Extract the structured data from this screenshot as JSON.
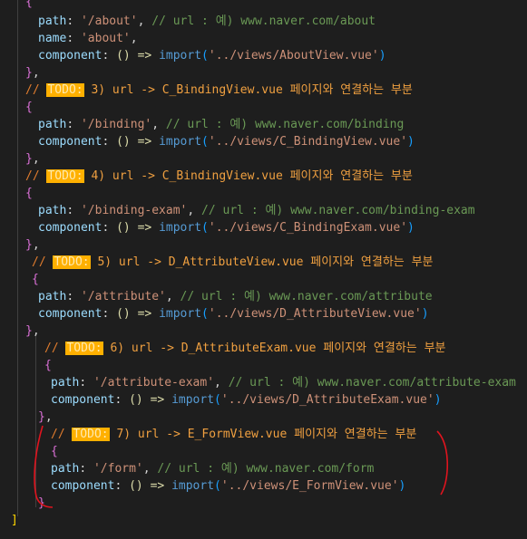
{
  "code": {
    "lines": [
      {
        "id": "l0",
        "segments": [
          {
            "t": "{",
            "c": "b2"
          }
        ]
      },
      {
        "id": "l1",
        "segments": [
          {
            "t": "path",
            "c": "k"
          },
          {
            "t": ": ",
            "c": "p"
          },
          {
            "t": "'/about'",
            "c": "s"
          },
          {
            "t": ", ",
            "c": "p"
          },
          {
            "t": "// url : 예) www.naver.com/about",
            "c": "c"
          }
        ]
      },
      {
        "id": "l2",
        "segments": [
          {
            "t": "name",
            "c": "k"
          },
          {
            "t": ": ",
            "c": "p"
          },
          {
            "t": "'about'",
            "c": "s"
          },
          {
            "t": ",",
            "c": "p"
          }
        ]
      },
      {
        "id": "l3",
        "segments": [
          {
            "t": "component",
            "c": "k"
          },
          {
            "t": ": ",
            "c": "p"
          },
          {
            "t": "() => ",
            "c": "f"
          },
          {
            "t": "import",
            "c": "kw"
          },
          {
            "t": "(",
            "c": "b3"
          },
          {
            "t": "'../views/AboutView.vue'",
            "c": "s"
          },
          {
            "t": ")",
            "c": "b3"
          }
        ]
      },
      {
        "id": "l4",
        "segments": [
          {
            "t": "}",
            "c": "b2"
          },
          {
            "t": ",",
            "c": "p"
          }
        ]
      },
      {
        "id": "l5",
        "todo": true,
        "segments": [
          {
            "t": "// ",
            "c": "todo-c"
          },
          {
            "t": "TODO:",
            "c": "todo"
          },
          {
            "t": " 3) url -> C_BindingView.vue 페이지와 연결하는 부분",
            "c": "todo-text"
          }
        ]
      },
      {
        "id": "l6",
        "segments": [
          {
            "t": "{",
            "c": "b2"
          }
        ]
      },
      {
        "id": "l7",
        "segments": [
          {
            "t": "path",
            "c": "k"
          },
          {
            "t": ": ",
            "c": "p"
          },
          {
            "t": "'/binding'",
            "c": "s"
          },
          {
            "t": ", ",
            "c": "p"
          },
          {
            "t": "// url : 예) www.naver.com/binding",
            "c": "c"
          }
        ]
      },
      {
        "id": "l8",
        "segments": [
          {
            "t": "component",
            "c": "k"
          },
          {
            "t": ": ",
            "c": "p"
          },
          {
            "t": "() => ",
            "c": "f"
          },
          {
            "t": "import",
            "c": "kw"
          },
          {
            "t": "(",
            "c": "b3"
          },
          {
            "t": "'../views/C_BindingView.vue'",
            "c": "s"
          },
          {
            "t": ")",
            "c": "b3"
          }
        ]
      },
      {
        "id": "l9",
        "segments": [
          {
            "t": "}",
            "c": "b2"
          },
          {
            "t": ",",
            "c": "p"
          }
        ]
      },
      {
        "id": "l10",
        "todo": true,
        "segments": [
          {
            "t": "// ",
            "c": "todo-c"
          },
          {
            "t": "TODO:",
            "c": "todo"
          },
          {
            "t": " 4) url -> C_BindingView.vue 페이지와 연결하는 부분",
            "c": "todo-text"
          }
        ]
      },
      {
        "id": "l11",
        "segments": [
          {
            "t": "{",
            "c": "b2"
          }
        ]
      },
      {
        "id": "l12",
        "segments": [
          {
            "t": "path",
            "c": "k"
          },
          {
            "t": ": ",
            "c": "p"
          },
          {
            "t": "'/binding-exam'",
            "c": "s"
          },
          {
            "t": ", ",
            "c": "p"
          },
          {
            "t": "// url : 예) www.naver.com/binding-exam",
            "c": "c"
          }
        ]
      },
      {
        "id": "l13",
        "segments": [
          {
            "t": "component",
            "c": "k"
          },
          {
            "t": ": ",
            "c": "p"
          },
          {
            "t": "() => ",
            "c": "f"
          },
          {
            "t": "import",
            "c": "kw"
          },
          {
            "t": "(",
            "c": "b3"
          },
          {
            "t": "'../views/C_BindingExam.vue'",
            "c": "s"
          },
          {
            "t": ")",
            "c": "b3"
          }
        ]
      },
      {
        "id": "l14",
        "segments": [
          {
            "t": "}",
            "c": "b2"
          },
          {
            "t": ",",
            "c": "p"
          }
        ]
      },
      {
        "id": "l15",
        "todo": true,
        "segments": [
          {
            "t": "// ",
            "c": "todo-c"
          },
          {
            "t": "TODO:",
            "c": "todo"
          },
          {
            "t": " 5) url -> D_AttributeView.vue 페이지와 연결하는 부분",
            "c": "todo-text"
          }
        ]
      },
      {
        "id": "l16",
        "segments": [
          {
            "t": "{",
            "c": "b2"
          }
        ]
      },
      {
        "id": "l17",
        "segments": [
          {
            "t": "path",
            "c": "k"
          },
          {
            "t": ": ",
            "c": "p"
          },
          {
            "t": "'/attribute'",
            "c": "s"
          },
          {
            "t": ", ",
            "c": "p"
          },
          {
            "t": "// url : 예) www.naver.com/attribute",
            "c": "c"
          }
        ]
      },
      {
        "id": "l18",
        "segments": [
          {
            "t": "component",
            "c": "k"
          },
          {
            "t": ": ",
            "c": "p"
          },
          {
            "t": "() => ",
            "c": "f"
          },
          {
            "t": "import",
            "c": "kw"
          },
          {
            "t": "(",
            "c": "b3"
          },
          {
            "t": "'../views/D_AttributeView.vue'",
            "c": "s"
          },
          {
            "t": ")",
            "c": "b3"
          }
        ]
      },
      {
        "id": "l19",
        "segments": [
          {
            "t": "}",
            "c": "b2"
          },
          {
            "t": ",",
            "c": "p"
          }
        ]
      },
      {
        "id": "l20",
        "todo": true,
        "segments": [
          {
            "t": "// ",
            "c": "todo-c"
          },
          {
            "t": "TODO:",
            "c": "todo"
          },
          {
            "t": " 6) url -> D_AttributeExam.vue 페이지와 연결하는 부분",
            "c": "todo-text"
          }
        ]
      },
      {
        "id": "l21",
        "segments": [
          {
            "t": "{",
            "c": "b2"
          }
        ]
      },
      {
        "id": "l22",
        "segments": [
          {
            "t": "path",
            "c": "k"
          },
          {
            "t": ": ",
            "c": "p"
          },
          {
            "t": "'/attribute-exam'",
            "c": "s"
          },
          {
            "t": ", ",
            "c": "p"
          },
          {
            "t": "// url : 예) www.naver.com/attribute-exam",
            "c": "c"
          }
        ]
      },
      {
        "id": "l23",
        "segments": [
          {
            "t": "component",
            "c": "k"
          },
          {
            "t": ": ",
            "c": "p"
          },
          {
            "t": "() => ",
            "c": "f"
          },
          {
            "t": "import",
            "c": "kw"
          },
          {
            "t": "(",
            "c": "b3"
          },
          {
            "t": "'../views/D_AttributeExam.vue'",
            "c": "s"
          },
          {
            "t": ")",
            "c": "b3"
          }
        ]
      },
      {
        "id": "l24",
        "segments": [
          {
            "t": "}",
            "c": "b2"
          },
          {
            "t": ",",
            "c": "p"
          }
        ]
      },
      {
        "id": "l25",
        "todo": true,
        "segments": [
          {
            "t": "// ",
            "c": "todo-c"
          },
          {
            "t": "TODO:",
            "c": "todo"
          },
          {
            "t": " 7) url -> E_FormView.vue 페이지와 연결하는 부분",
            "c": "todo-text"
          }
        ]
      },
      {
        "id": "l26",
        "segments": [
          {
            "t": "{",
            "c": "b2"
          }
        ]
      },
      {
        "id": "l27",
        "segments": [
          {
            "t": "path",
            "c": "k"
          },
          {
            "t": ": ",
            "c": "p"
          },
          {
            "t": "'/form'",
            "c": "s"
          },
          {
            "t": ", ",
            "c": "p"
          },
          {
            "t": "// url : 예) www.naver.com/form",
            "c": "c"
          }
        ]
      },
      {
        "id": "l28",
        "segments": [
          {
            "t": "component",
            "c": "k"
          },
          {
            "t": ": ",
            "c": "p"
          },
          {
            "t": "() => ",
            "c": "f"
          },
          {
            "t": "import",
            "c": "kw"
          },
          {
            "t": "(",
            "c": "b3"
          },
          {
            "t": "'../views/E_FormView.vue'",
            "c": "s"
          },
          {
            "t": ")",
            "c": "b3"
          }
        ]
      },
      {
        "id": "l29",
        "segments": [
          {
            "t": "}",
            "c": "b2"
          }
        ]
      },
      {
        "id": "l30",
        "segments": [
          {
            "t": "]",
            "c": "b1"
          }
        ]
      }
    ]
  },
  "colors": {
    "background": "#1e1e1e",
    "annotation": "#e0141e",
    "todo_highlight": "#ffb000"
  }
}
